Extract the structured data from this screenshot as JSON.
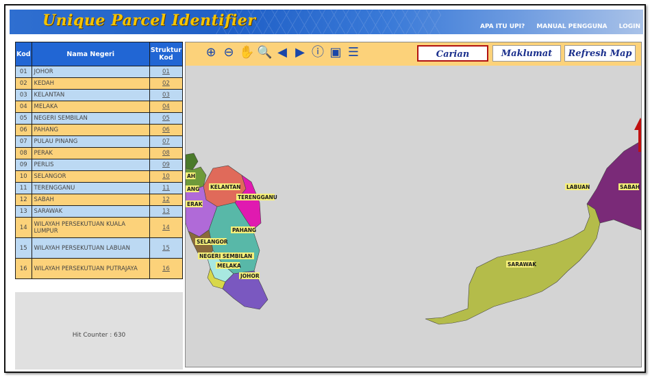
{
  "app": {
    "title": "Unique Parcel Identifier"
  },
  "topnav": {
    "items": [
      "APA ITU UPI?",
      "MANUAL PENGGUNA",
      "LOGIN"
    ]
  },
  "table": {
    "headers": {
      "kod": "Kod",
      "nama": "Nama Negeri",
      "struktur": "Struktur Kod"
    },
    "rows": [
      {
        "kod": "01",
        "nama": "JOHOR",
        "struktur": "01"
      },
      {
        "kod": "02",
        "nama": "KEDAH",
        "struktur": "02"
      },
      {
        "kod": "03",
        "nama": "KELANTAN",
        "struktur": "03"
      },
      {
        "kod": "04",
        "nama": "MELAKA",
        "struktur": "04"
      },
      {
        "kod": "05",
        "nama": "NEGERI SEMBILAN",
        "struktur": "05"
      },
      {
        "kod": "06",
        "nama": "PAHANG",
        "struktur": "06"
      },
      {
        "kod": "07",
        "nama": "PULAU PINANG",
        "struktur": "07"
      },
      {
        "kod": "08",
        "nama": "PERAK",
        "struktur": "08"
      },
      {
        "kod": "09",
        "nama": "PERLIS",
        "struktur": "09"
      },
      {
        "kod": "10",
        "nama": "SELANGOR",
        "struktur": "10"
      },
      {
        "kod": "11",
        "nama": "TERENGGANU",
        "struktur": "11"
      },
      {
        "kod": "12",
        "nama": "SABAH",
        "struktur": "12"
      },
      {
        "kod": "13",
        "nama": "SARAWAK",
        "struktur": "13"
      },
      {
        "kod": "14",
        "nama": "WILAYAH PERSEKUTUAN KUALA LUMPUR",
        "struktur": "14"
      },
      {
        "kod": "15",
        "nama": "WILAYAH PERSEKUTUAN LABUAN",
        "struktur": "15"
      },
      {
        "kod": "16",
        "nama": "WILAYAH PERSEKUTUAN PUTRAJAYA",
        "struktur": "16"
      }
    ]
  },
  "hit_counter": "Hit Counter : 630",
  "toolbar": {
    "tools": [
      {
        "name": "zoom-in-icon",
        "glyph": "⊕"
      },
      {
        "name": "zoom-out-icon",
        "glyph": "⊖"
      },
      {
        "name": "pan-hand-icon",
        "glyph": "✋"
      },
      {
        "name": "zoom-box-icon",
        "glyph": "🔍"
      },
      {
        "name": "back-icon",
        "glyph": "◀"
      },
      {
        "name": "forward-icon",
        "glyph": "▶"
      },
      {
        "name": "info-icon",
        "glyph": "ⓘ"
      },
      {
        "name": "full-extent-map-icon",
        "glyph": "▣"
      },
      {
        "name": "legend-list-icon",
        "glyph": "☰"
      }
    ],
    "buttons": {
      "carian": "Carian",
      "maklumat": "Maklumat",
      "refresh": "Refresh Map"
    }
  },
  "map": {
    "labels": {
      "kedah": "AH",
      "penang": "ANG",
      "kelantan": "KELANTAN",
      "terengganu": "TERENGGANU",
      "perak": "ERAK",
      "pahang": "PAHANG",
      "selangor": "SELANGOR",
      "nsembilan": "NEGERI SEMBILAN",
      "melaka": "MELAKA",
      "johor": "JOHOR",
      "sarawak": "SARAWAK",
      "labuan": "LABUAN",
      "sabah": "SABAH"
    },
    "colors": {
      "kedah": "#6e9a3a",
      "perlis": "#4a7a2a",
      "kelantan": "#e06a5a",
      "terengganu": "#e01ab0",
      "perak": "#b06ad8",
      "pahang": "#58b8a8",
      "selangor": "#8a6a3a",
      "nsembilan": "#a8e8e0",
      "melaka": "#d8d84a",
      "johor": "#7a58c0",
      "sarawak": "#b4bc4a",
      "sabah": "#7a2a78",
      "arrow": "#c01010"
    }
  }
}
